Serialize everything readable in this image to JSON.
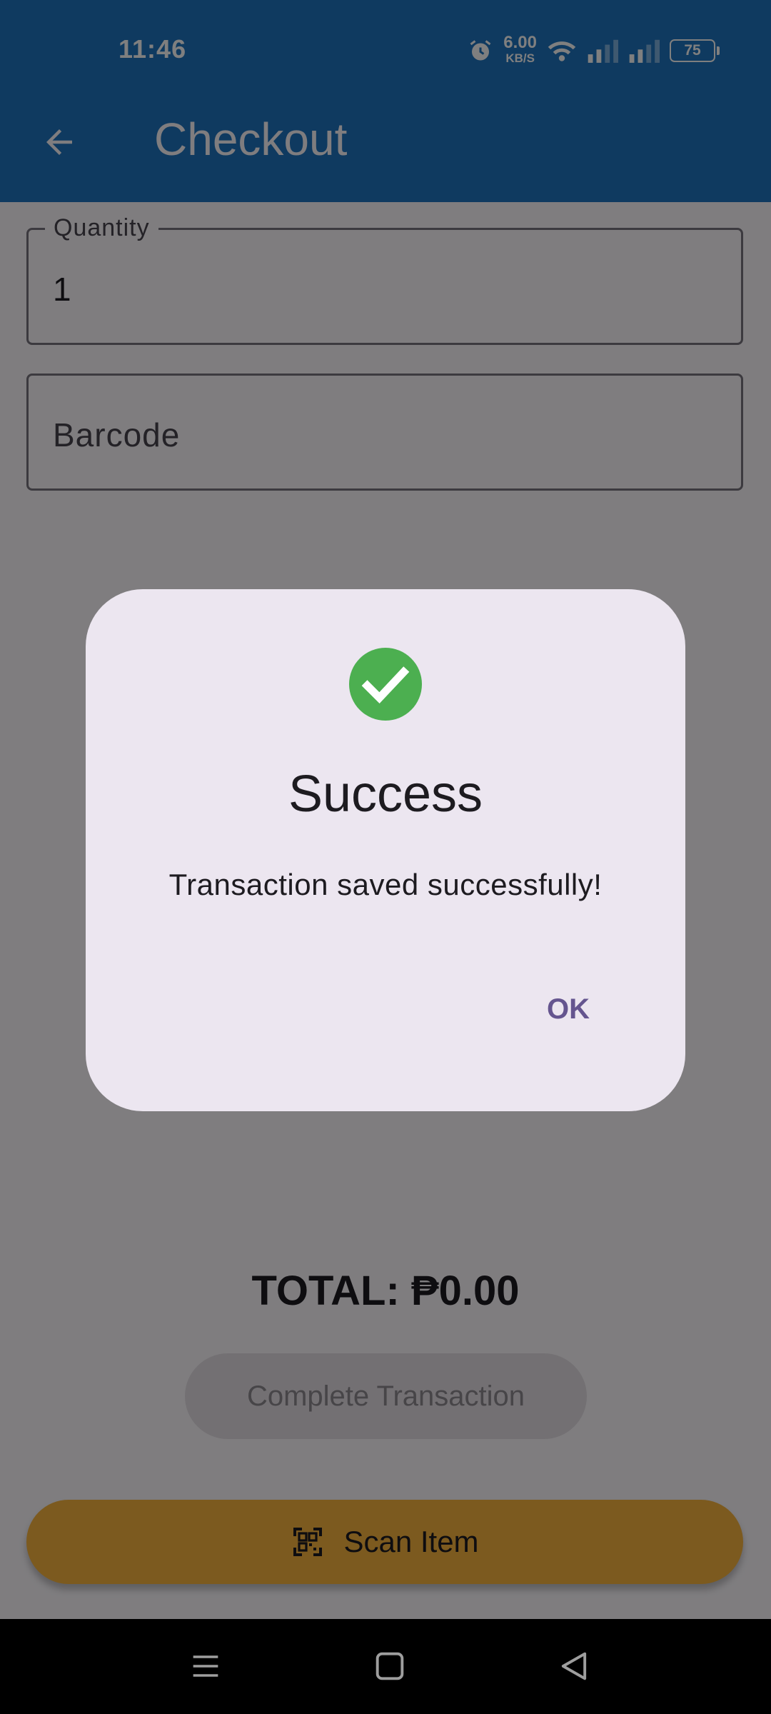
{
  "status_bar": {
    "time": "11:46",
    "net_speed_value": "6.00",
    "net_speed_unit": "KB/S",
    "battery": "75",
    "icons": [
      "alarm-icon",
      "wifi-icon",
      "signal-icon",
      "signal-icon",
      "battery-icon"
    ]
  },
  "app_bar": {
    "title": "Checkout",
    "back_icon": "arrow-back-icon"
  },
  "form": {
    "quantity_label": "Quantity",
    "quantity_value": "1",
    "barcode_placeholder": "Barcode"
  },
  "total": {
    "text": "TOTAL: ₱0.00"
  },
  "buttons": {
    "complete_transaction": "Complete Transaction",
    "scan_item": "Scan Item"
  },
  "dialog": {
    "icon": "check-circle-icon",
    "title": "Success",
    "message": "Transaction saved successfully!",
    "ok_label": "OK"
  },
  "colors": {
    "app_bar": "#1e74c0",
    "scan_button": "#f9b43e",
    "success_icon": "#4caf50",
    "dialog_action": "#65558f"
  },
  "nav_bar": {
    "icons": [
      "menu-icon",
      "home-icon",
      "back-icon"
    ]
  }
}
